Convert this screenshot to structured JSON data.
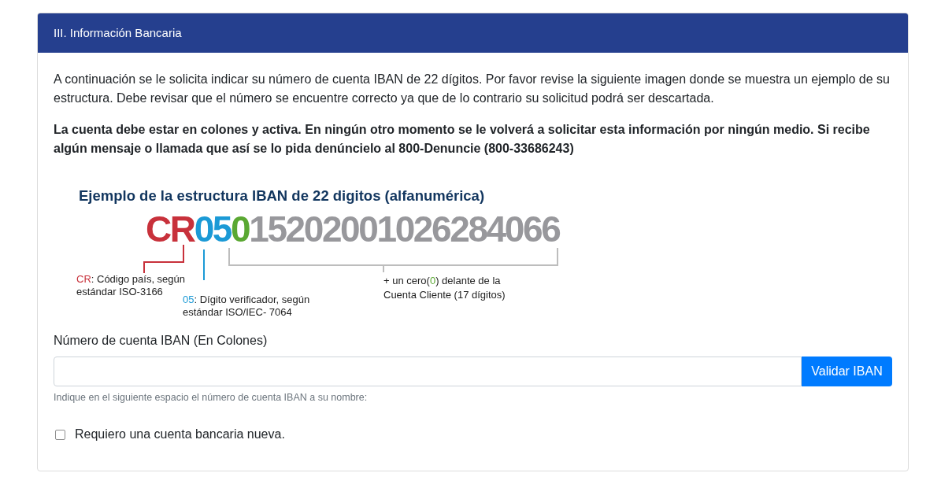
{
  "panel": {
    "title": "III. Información Bancaria"
  },
  "intro": "A continuación se le solicita indicar su número de cuenta IBAN de 22 dígitos. Por favor revise la siguiente imagen donde se muestra un ejemplo de su estructura. Debe revisar que el número se encuentre correcto ya que de lo contrario su solicitud podrá ser descartada.",
  "notice": "La cuenta debe estar en colones y activa. En ningún otro momento se le volverá a solicitar esta información por ningún medio. Si recibe algún mensaje o llamada que así se lo pida denúncielo al 800-Denuncie (800-33686243)",
  "iban_example": {
    "title": "Ejemplo de la estructura IBAN de 22 digitos (alfanumérica)",
    "segments": [
      {
        "text": "CR",
        "color": "#c8313b"
      },
      {
        "text": "05",
        "color": "#1b9ad6"
      },
      {
        "text": "0",
        "color": "#5aa832"
      },
      {
        "text": "15202001026284066",
        "color": "#98989c"
      }
    ],
    "annotations": [
      {
        "parts": [
          {
            "text": "CR",
            "color": "#c8313b"
          },
          {
            "text": ": Código país, según estándar ISO-3166"
          }
        ]
      },
      {
        "parts": [
          {
            "text": "05",
            "color": "#1b9ad6"
          },
          {
            "text": ": Dígito verificador, según estándar ISO/IEC- 7064"
          }
        ]
      },
      {
        "parts": [
          {
            "text": "+ un cero("
          },
          {
            "text": "0",
            "color": "#5aa832"
          },
          {
            "text": ") delante de la Cuenta Cliente (17 dígitos)"
          }
        ]
      }
    ]
  },
  "iban_field": {
    "label": "Número de cuenta IBAN (En Colones)",
    "button": "Validar IBAN",
    "help": "Indique en el siguiente espacio el número de cuenta IBAN a su nombre:"
  },
  "new_account": {
    "label": "Requiero una cuenta bancaria nueva.",
    "checked": false
  }
}
